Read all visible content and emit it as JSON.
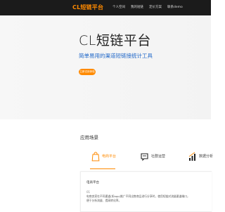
{
  "nav": {
    "brand": "CL短链平台",
    "links": [
      "个人空间",
      "我的短链",
      "定价方案",
      "联系demo"
    ]
  },
  "hero": {
    "title": "CL短链平台",
    "subtitle": "简单易用的渠道短链接统计工具",
    "cta": "立即试用体验"
  },
  "scenes": {
    "title": "应用场景",
    "tabs": [
      {
        "label": "电商平台",
        "icon": "shopping-bag-icon",
        "active": true
      },
      {
        "label": "社群运营",
        "icon": "chat-bubble-icon",
        "active": false
      },
      {
        "label": "数据分析",
        "icon": "bar-chart-icon",
        "active": false
      }
    ],
    "card": {
      "title": "电商平台",
      "number": "01",
      "line1": "电商卖家在不同渠道(如app)推广不同出售商品进行分享时，使用短链对流量渠道端口，",
      "line2": "便于分析流量、提高转化率。"
    }
  },
  "colors": {
    "accent": "#ff8a00",
    "navbar": "#1b1b1b",
    "subtitle": "#1e66c8"
  }
}
